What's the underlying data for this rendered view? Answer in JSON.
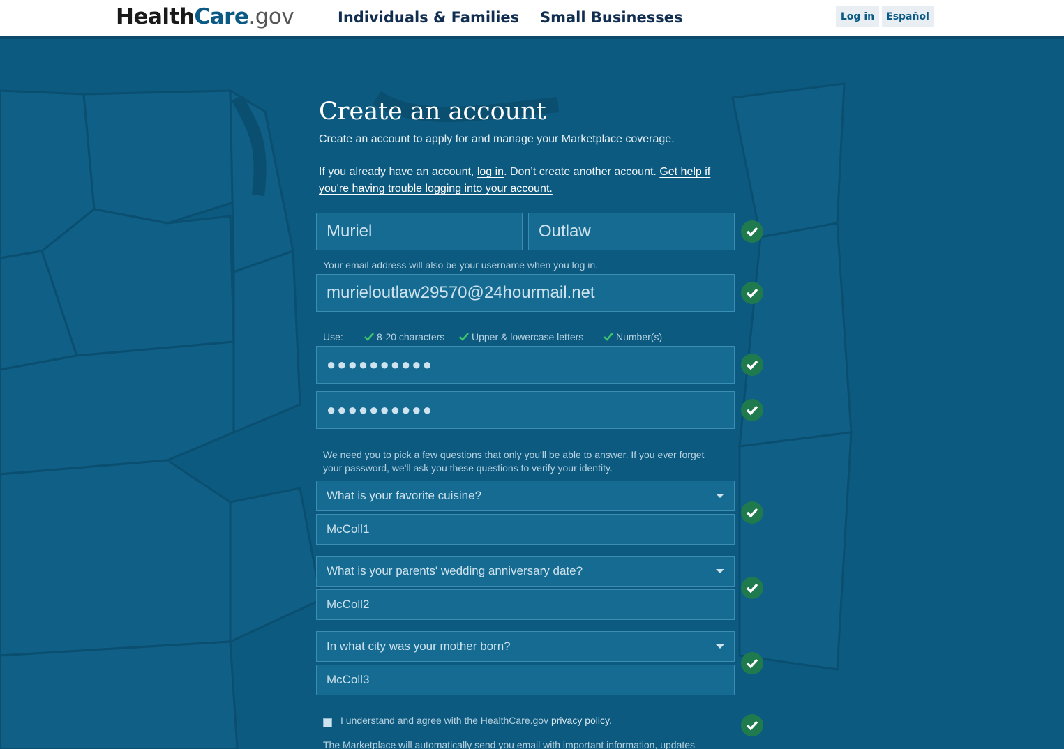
{
  "header": {
    "logo_main": "Health",
    "logo_care": "Care",
    "logo_gov": ".gov",
    "nav": [
      "Individuals & Families",
      "Small Businesses"
    ],
    "login_label": "Log in",
    "espanol_label": "Español"
  },
  "page": {
    "title": "Create an account",
    "subtitle": "Create an account to apply for and manage your Marketplace coverage.",
    "para_1": "If you already have an account, ",
    "login_link": "log in",
    "para_2": ". Don’t create another account. ",
    "help_link": "Get help if you're having trouble logging into your account."
  },
  "form": {
    "first_name": "Muriel",
    "last_name": "Outlaw",
    "email_hint": "Your email address will also be your username when you log in.",
    "email": "murieloutlaw29570@24hourmail.net",
    "password_use_label": "Use:",
    "password_rules": [
      "8-20 characters",
      "Upper & lowercase letters",
      "Number(s)"
    ],
    "password_mask": "●●●●●●●●●●",
    "confirm_mask": "●●●●●●●●●●",
    "questions_hint": "We need you to pick a few questions that only you'll be able to answer. If you ever forget your password, we'll ask you these questions to verify your identity.",
    "q1": "What is your favorite cuisine?",
    "a1": "McColl1",
    "q2": "What is your parents' wedding anniversary date?",
    "a2": "McColl2",
    "q3": "In what city was your mother born?",
    "a3": "McColl3",
    "agree_text": "I understand and agree with the HealthCare.gov ",
    "privacy_link": "privacy policy.",
    "bottom_text": "The Marketplace will automatically send you email with important information, updates"
  },
  "colors": {
    "background": "#0d5a80",
    "field": "#156b92",
    "check": "#1f7a4e",
    "check_green": "#3cc46b"
  },
  "icons": [
    "check-icon",
    "chevron-down-icon",
    "map-background"
  ]
}
